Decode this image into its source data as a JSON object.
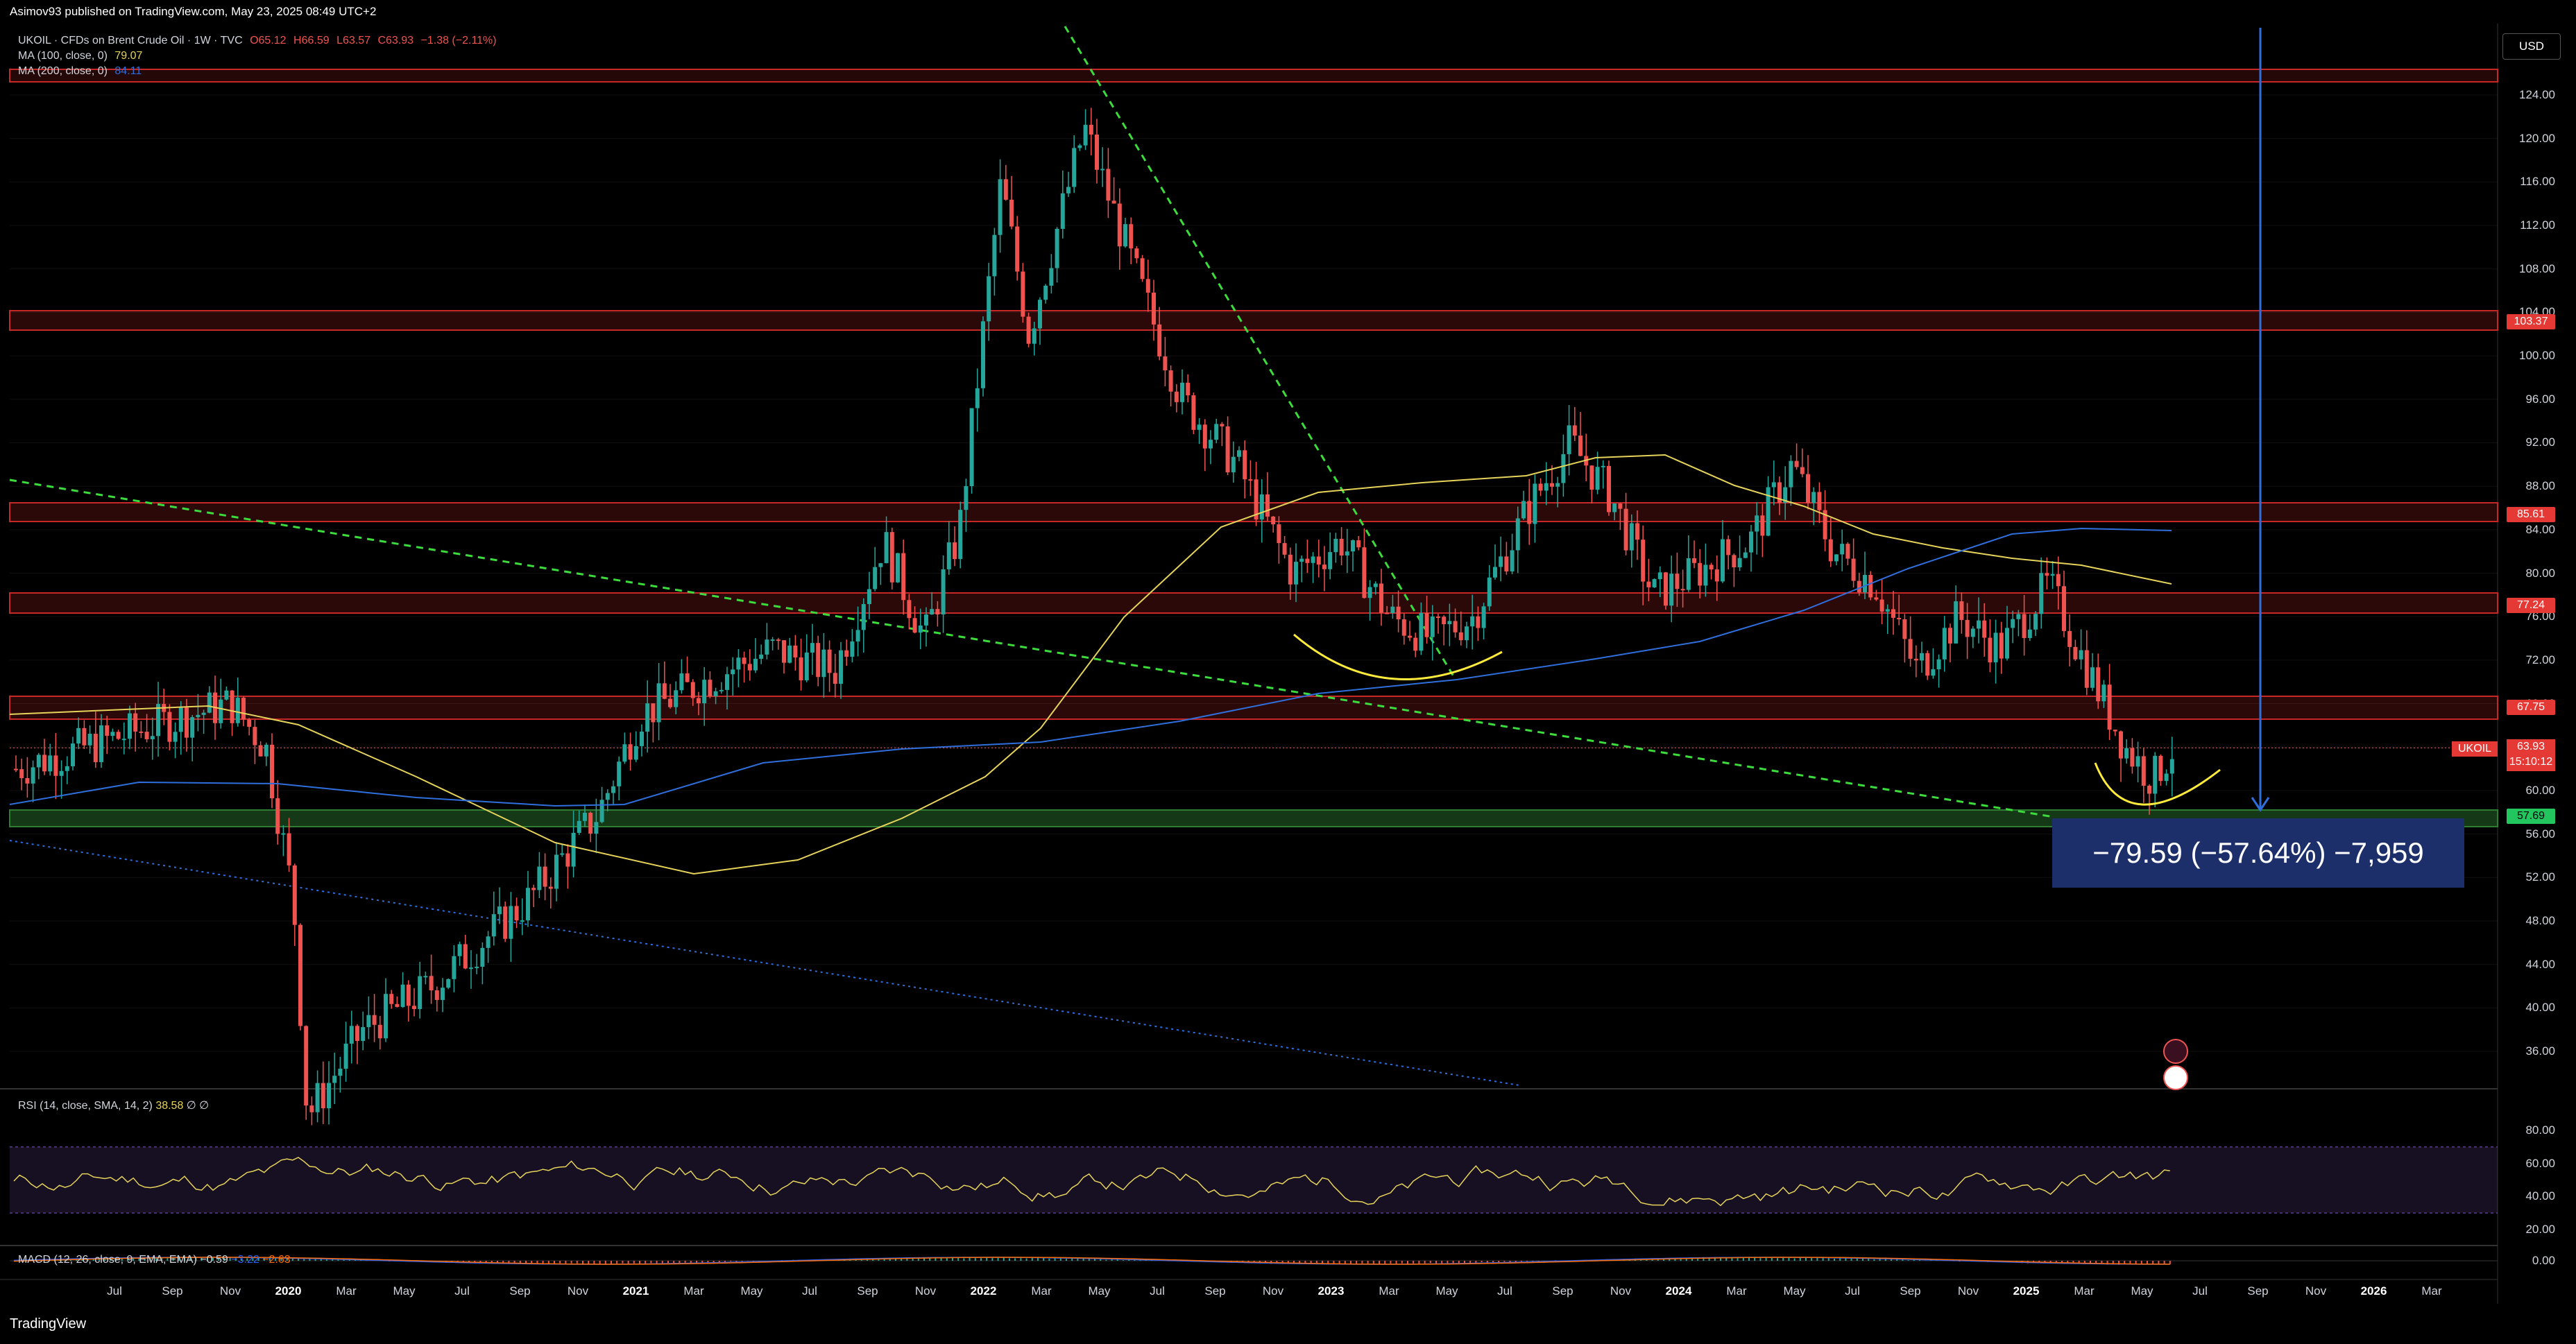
{
  "header": {
    "published": "Asimov93 published on TradingView.com, May 23, 2025 08:49 UTC+2"
  },
  "legend": {
    "symbol": "UKOIL · CFDs on Brent Crude Oil · 1W · TVC",
    "o": "O65.12",
    "h": "H66.59",
    "l": "L63.57",
    "c": "C63.93",
    "chg": "−1.38 (−2.11%)",
    "ma100": "MA (100, close, 0)",
    "ma100_val": "79.07",
    "ma200": "MA (200, close, 0)",
    "ma200_val": "84.11"
  },
  "currency_button": "USD",
  "y_axis": {
    "ticks": [
      "124.00",
      "120.00",
      "116.00",
      "112.00",
      "108.00",
      "104.00",
      "100.00",
      "96.00",
      "92.00",
      "88.00",
      "84.00",
      "80.00",
      "76.00",
      "72.00",
      "68.00",
      "64.00",
      "60.00",
      "56.00",
      "52.00",
      "48.00",
      "44.00",
      "40.00",
      "36.00"
    ]
  },
  "level_tags": {
    "l103": "103.37",
    "l85": "85.61",
    "l77": "77.24",
    "l67": "67.75",
    "l57": "57.69"
  },
  "current_price": {
    "symbol": "UKOIL",
    "price": "63.93",
    "countdown": "15:10:12"
  },
  "measurement": "−79.59 (−57.64%) −7,959",
  "rsi": {
    "label": "RSI (14, close, SMA, 14, 2)",
    "value": "38.58",
    "extra": "∅ ∅",
    "ticks": [
      "80.00",
      "60.00",
      "40.00",
      "20.00"
    ]
  },
  "macd": {
    "label": "MACD (12, 26, close, 9, EMA, EMA)",
    "v1": "−0.59",
    "v2": "−3.22",
    "v3": "−2.63",
    "ticks": [
      "0.00"
    ]
  },
  "x_axis": [
    "Jul",
    "Sep",
    "Nov",
    "2020",
    "Mar",
    "May",
    "Jul",
    "Sep",
    "Nov",
    "2021",
    "Mar",
    "May",
    "Jul",
    "Sep",
    "Nov",
    "2022",
    "Mar",
    "May",
    "Jul",
    "Sep",
    "Nov",
    "2023",
    "Mar",
    "May",
    "Jul",
    "Sep",
    "Nov",
    "2024",
    "Mar",
    "May",
    "Jul",
    "Sep",
    "Nov",
    "2025",
    "Mar",
    "May",
    "Jul",
    "Sep",
    "Nov",
    "2026",
    "Mar"
  ],
  "footer": {
    "brand": "TradingView"
  },
  "colors": {
    "up": "#26a69a",
    "down": "#ef5350",
    "ma100": "#e6d35a",
    "ma200": "#2f6fdd",
    "trend": "#3cdc3c"
  }
}
